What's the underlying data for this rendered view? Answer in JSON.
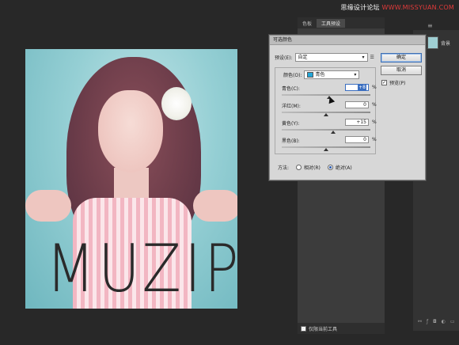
{
  "watermark": {
    "prefix": "思缘设计论坛",
    "suffix": "WWW.MISSYUAN.COM",
    "accent": "#e03a3a"
  },
  "photo": {
    "brand_text": "MUZIPR",
    "brand_sub": ""
  },
  "panel_mid": {
    "tabs": [
      "色板",
      "工具预设"
    ],
    "active_tab": 1,
    "footer_label": "仅限当前工具"
  },
  "panel_right": {
    "layer_label": "背景"
  },
  "dialog": {
    "title": "可选颜色",
    "preset_label": "预设(E):",
    "preset_value": "自定",
    "ok_label": "确定",
    "cancel_label": "取消",
    "preview_label": "预览(P)",
    "preview_checked": true,
    "color_label": "颜色(O):",
    "color_value": "青色",
    "color_swatch": "#22a6d8",
    "sliders": [
      {
        "label": "青色(C):",
        "value": "+8",
        "percent": "%",
        "level": 0.54,
        "focused": true
      },
      {
        "label": "洋红(M):",
        "value": "0",
        "percent": "%",
        "level": 0.5,
        "focused": false
      },
      {
        "label": "黄色(Y):",
        "value": "+15",
        "percent": "%",
        "level": 0.58,
        "focused": false
      },
      {
        "label": "黑色(B):",
        "value": "0",
        "percent": "%",
        "level": 0.5,
        "focused": false
      }
    ],
    "method_label": "方法:",
    "method_relative": "相对(R)",
    "method_absolute": "绝对(A)",
    "method_selected": "absolute"
  }
}
